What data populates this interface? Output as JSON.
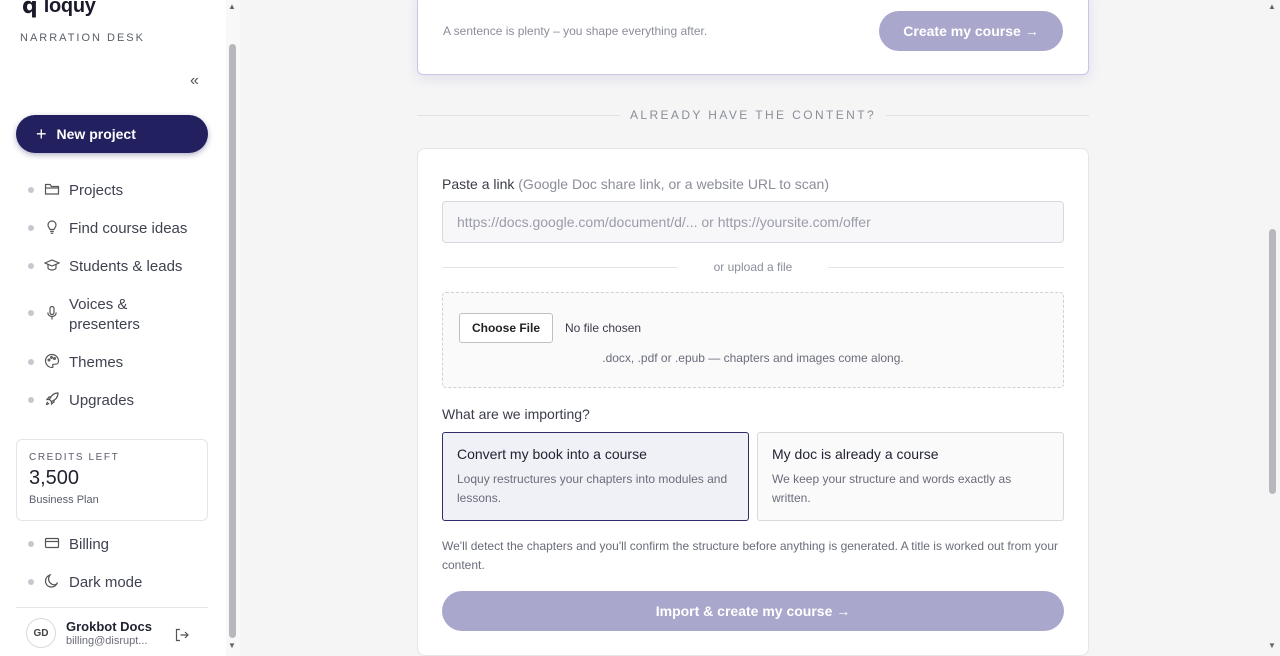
{
  "sidebar": {
    "logo_mark": "q",
    "logo_text": "loquy",
    "tagline": "NARRATION DESK",
    "collapse_glyph": "«",
    "new_project": "New project",
    "items": [
      {
        "label": "Projects",
        "icon": "folder-icon"
      },
      {
        "label": "Find course ideas",
        "icon": "lightbulb-icon"
      },
      {
        "label": "Students & leads",
        "icon": "graduation-cap-icon"
      },
      {
        "label": "Voices &\npresenters",
        "icon": "microphone-icon"
      },
      {
        "label": "Themes",
        "icon": "palette-icon"
      },
      {
        "label": "Upgrades",
        "icon": "rocket-icon"
      }
    ],
    "credits": {
      "label": "CREDITS LEFT",
      "value": "3,500",
      "plan": "Business Plan"
    },
    "bottom_items": [
      {
        "label": "Billing",
        "icon": "card-icon"
      },
      {
        "label": "Dark mode",
        "icon": "moon-icon"
      }
    ],
    "user": {
      "initials": "GD",
      "name": "Grokbot Docs",
      "email": "billing@disrupt..."
    }
  },
  "top_card": {
    "hint": "A sentence is plenty – you shape everything after.",
    "create_button": "Create my course →"
  },
  "divider_label": "ALREADY HAVE THE CONTENT?",
  "import": {
    "paste_label": "Paste a link",
    "paste_hint": "(Google Doc share link, or a website URL to scan)",
    "url_placeholder": "https://docs.google.com/document/d/... or https://yoursite.com/offer",
    "url_value": "",
    "or_upload": "or upload a file",
    "choose_file": "Choose File",
    "no_file": "No file chosen",
    "drop_hint": ".docx, .pdf or .epub — chapters and images come along.",
    "question": "What are we importing?",
    "options": [
      {
        "title": "Convert my book into a course",
        "desc": "Loquy restructures your chapters into modules and lessons.",
        "selected": true
      },
      {
        "title": "My doc is already a course",
        "desc": "We keep your structure and words exactly as written.",
        "selected": false
      }
    ],
    "detect_note": "We'll detect the chapters and you'll confirm the structure before anything is generated. A title is worked out from your content.",
    "import_button": "Import & create my course →"
  },
  "colors": {
    "brand": "#22205e",
    "disabled_button": "#a9a7cc",
    "selected_border": "#2f2c6e"
  }
}
